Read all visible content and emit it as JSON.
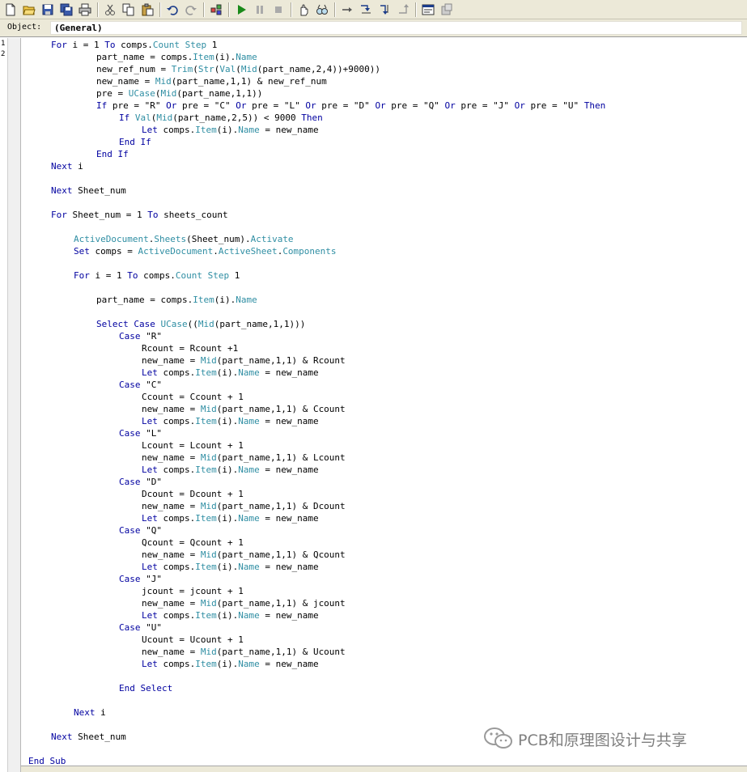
{
  "toolbar": {
    "icons": [
      "new-file-icon",
      "open-folder-icon",
      "save-icon",
      "save-all-icon",
      "print-icon",
      "cut-icon",
      "copy-icon",
      "paste-icon",
      "undo-icon",
      "redo-icon",
      "object-browser-icon",
      "run-icon",
      "pause-icon",
      "stop-icon",
      "hand-icon",
      "watch-icon",
      "step-icon",
      "step-into-icon",
      "step-over-icon",
      "step-out-icon",
      "properties-icon",
      "toggle-icon"
    ]
  },
  "object_bar": {
    "label": "Object:",
    "value": "(General)"
  },
  "gutter": {
    "line_numbers": [
      "1",
      "2"
    ]
  },
  "code": {
    "lines": [
      [
        {
          "t": "For",
          "c": "kw"
        },
        {
          "t": " i = 1 ",
          "c": "tx"
        },
        {
          "t": "To",
          "c": "kw"
        },
        {
          "t": " comps.",
          "c": "tx"
        },
        {
          "t": "Count",
          "c": "fn"
        },
        {
          "t": " ",
          "c": "tx"
        },
        {
          "t": "Step",
          "c": "fn"
        },
        {
          "t": " 1",
          "c": "tx"
        }
      ],
      [
        {
          "t": "part_name = comps.",
          "c": "tx"
        },
        {
          "t": "Item",
          "c": "fn"
        },
        {
          "t": "(i).",
          "c": "tx"
        },
        {
          "t": "Name",
          "c": "fn"
        }
      ],
      [
        {
          "t": "new_ref_num = ",
          "c": "tx"
        },
        {
          "t": "Trim",
          "c": "fn"
        },
        {
          "t": "(",
          "c": "tx"
        },
        {
          "t": "Str",
          "c": "fn"
        },
        {
          "t": "(",
          "c": "tx"
        },
        {
          "t": "Val",
          "c": "fn"
        },
        {
          "t": "(",
          "c": "tx"
        },
        {
          "t": "Mid",
          "c": "fn"
        },
        {
          "t": "(part_name,2,4))+9000))",
          "c": "tx"
        }
      ],
      [
        {
          "t": "new_name = ",
          "c": "tx"
        },
        {
          "t": "Mid",
          "c": "fn"
        },
        {
          "t": "(part_name,1,1) & new_ref_num",
          "c": "tx"
        }
      ],
      [
        {
          "t": "pre = ",
          "c": "tx"
        },
        {
          "t": "UCase",
          "c": "fn"
        },
        {
          "t": "(",
          "c": "tx"
        },
        {
          "t": "Mid",
          "c": "fn"
        },
        {
          "t": "(part_name,1,1))",
          "c": "tx"
        }
      ],
      [
        {
          "t": "If",
          "c": "kw"
        },
        {
          "t": " pre = \"R\" ",
          "c": "tx"
        },
        {
          "t": "Or",
          "c": "kw"
        },
        {
          "t": " pre = \"C\" ",
          "c": "tx"
        },
        {
          "t": "Or",
          "c": "kw"
        },
        {
          "t": " pre = \"L\" ",
          "c": "tx"
        },
        {
          "t": "Or",
          "c": "kw"
        },
        {
          "t": " pre = \"D\" ",
          "c": "tx"
        },
        {
          "t": "Or",
          "c": "kw"
        },
        {
          "t": " pre = \"Q\" ",
          "c": "tx"
        },
        {
          "t": "Or",
          "c": "kw"
        },
        {
          "t": " pre = \"J\" ",
          "c": "tx"
        },
        {
          "t": "Or",
          "c": "kw"
        },
        {
          "t": " pre = \"U\" ",
          "c": "tx"
        },
        {
          "t": "Then",
          "c": "kw"
        }
      ],
      [
        {
          "t": "If",
          "c": "kw"
        },
        {
          "t": " ",
          "c": "tx"
        },
        {
          "t": "Val",
          "c": "fn"
        },
        {
          "t": "(",
          "c": "tx"
        },
        {
          "t": "Mid",
          "c": "fn"
        },
        {
          "t": "(part_name,2,5)) < 9000 ",
          "c": "tx"
        },
        {
          "t": "Then",
          "c": "kw"
        }
      ],
      [
        {
          "t": "Let",
          "c": "kw"
        },
        {
          "t": " comps.",
          "c": "tx"
        },
        {
          "t": "Item",
          "c": "fn"
        },
        {
          "t": "(i).",
          "c": "tx"
        },
        {
          "t": "Name",
          "c": "fn"
        },
        {
          "t": " = new_name",
          "c": "tx"
        }
      ],
      [
        {
          "t": "End If",
          "c": "kw"
        }
      ],
      [
        {
          "t": "End If",
          "c": "kw"
        }
      ],
      [
        {
          "t": "Next",
          "c": "kw"
        },
        {
          "t": " i",
          "c": "tx"
        }
      ],
      [],
      [
        {
          "t": "Next",
          "c": "kw"
        },
        {
          "t": " Sheet_num",
          "c": "tx"
        }
      ],
      [],
      [
        {
          "t": "For",
          "c": "kw"
        },
        {
          "t": " Sheet_num = 1 ",
          "c": "tx"
        },
        {
          "t": "To",
          "c": "kw"
        },
        {
          "t": " sheets_count",
          "c": "tx"
        }
      ],
      [],
      [
        {
          "t": "ActiveDocument",
          "c": "fn"
        },
        {
          "t": ".",
          "c": "tx"
        },
        {
          "t": "Sheets",
          "c": "fn"
        },
        {
          "t": "(Sheet_num).",
          "c": "tx"
        },
        {
          "t": "Activate",
          "c": "fn"
        }
      ],
      [
        {
          "t": "Set",
          "c": "kw"
        },
        {
          "t": " comps = ",
          "c": "tx"
        },
        {
          "t": "ActiveDocument",
          "c": "fn"
        },
        {
          "t": ".",
          "c": "tx"
        },
        {
          "t": "ActiveSheet",
          "c": "fn"
        },
        {
          "t": ".",
          "c": "tx"
        },
        {
          "t": "Components",
          "c": "fn"
        }
      ],
      [],
      [
        {
          "t": "For",
          "c": "kw"
        },
        {
          "t": " i = 1 ",
          "c": "tx"
        },
        {
          "t": "To",
          "c": "kw"
        },
        {
          "t": " comps.",
          "c": "tx"
        },
        {
          "t": "Count",
          "c": "fn"
        },
        {
          "t": " ",
          "c": "tx"
        },
        {
          "t": "Step",
          "c": "fn"
        },
        {
          "t": " 1",
          "c": "tx"
        }
      ],
      [],
      [
        {
          "t": "part_name = comps.",
          "c": "tx"
        },
        {
          "t": "Item",
          "c": "fn"
        },
        {
          "t": "(i).",
          "c": "tx"
        },
        {
          "t": "Name",
          "c": "fn"
        }
      ],
      [],
      [
        {
          "t": "Select Case",
          "c": "kw"
        },
        {
          "t": " ",
          "c": "tx"
        },
        {
          "t": "UCase",
          "c": "fn"
        },
        {
          "t": "((",
          "c": "tx"
        },
        {
          "t": "Mid",
          "c": "fn"
        },
        {
          "t": "(part_name,1,1)))",
          "c": "tx"
        }
      ],
      [
        {
          "t": "Case",
          "c": "kw"
        },
        {
          "t": " \"R\"",
          "c": "tx"
        }
      ],
      [
        {
          "t": "Rcount = Rcount +1",
          "c": "tx"
        }
      ],
      [
        {
          "t": "new_name = ",
          "c": "tx"
        },
        {
          "t": "Mid",
          "c": "fn"
        },
        {
          "t": "(part_name,1,1) & Rcount",
          "c": "tx"
        }
      ],
      [
        {
          "t": "Let",
          "c": "kw"
        },
        {
          "t": " comps.",
          "c": "tx"
        },
        {
          "t": "Item",
          "c": "fn"
        },
        {
          "t": "(i).",
          "c": "tx"
        },
        {
          "t": "Name",
          "c": "fn"
        },
        {
          "t": " = new_name",
          "c": "tx"
        }
      ],
      [
        {
          "t": "Case",
          "c": "kw"
        },
        {
          "t": " \"C\"",
          "c": "tx"
        }
      ],
      [
        {
          "t": "Ccount = Ccount + 1",
          "c": "tx"
        }
      ],
      [
        {
          "t": "new_name = ",
          "c": "tx"
        },
        {
          "t": "Mid",
          "c": "fn"
        },
        {
          "t": "(part_name,1,1) & Ccount",
          "c": "tx"
        }
      ],
      [
        {
          "t": "Let",
          "c": "kw"
        },
        {
          "t": " comps.",
          "c": "tx"
        },
        {
          "t": "Item",
          "c": "fn"
        },
        {
          "t": "(i).",
          "c": "tx"
        },
        {
          "t": "Name",
          "c": "fn"
        },
        {
          "t": " = new_name",
          "c": "tx"
        }
      ],
      [
        {
          "t": "Case",
          "c": "kw"
        },
        {
          "t": " \"L\"",
          "c": "tx"
        }
      ],
      [
        {
          "t": "Lcount = Lcount + 1",
          "c": "tx"
        }
      ],
      [
        {
          "t": "new_name = ",
          "c": "tx"
        },
        {
          "t": "Mid",
          "c": "fn"
        },
        {
          "t": "(part_name,1,1) & Lcount",
          "c": "tx"
        }
      ],
      [
        {
          "t": "Let",
          "c": "kw"
        },
        {
          "t": " comps.",
          "c": "tx"
        },
        {
          "t": "Item",
          "c": "fn"
        },
        {
          "t": "(i).",
          "c": "tx"
        },
        {
          "t": "Name",
          "c": "fn"
        },
        {
          "t": " = new_name",
          "c": "tx"
        }
      ],
      [
        {
          "t": "Case",
          "c": "kw"
        },
        {
          "t": " \"D\"",
          "c": "tx"
        }
      ],
      [
        {
          "t": "Dcount = Dcount + 1",
          "c": "tx"
        }
      ],
      [
        {
          "t": "new_name = ",
          "c": "tx"
        },
        {
          "t": "Mid",
          "c": "fn"
        },
        {
          "t": "(part_name,1,1) & Dcount",
          "c": "tx"
        }
      ],
      [
        {
          "t": "Let",
          "c": "kw"
        },
        {
          "t": " comps.",
          "c": "tx"
        },
        {
          "t": "Item",
          "c": "fn"
        },
        {
          "t": "(i).",
          "c": "tx"
        },
        {
          "t": "Name",
          "c": "fn"
        },
        {
          "t": " = new_name",
          "c": "tx"
        }
      ],
      [
        {
          "t": "Case",
          "c": "kw"
        },
        {
          "t": " \"Q\"",
          "c": "tx"
        }
      ],
      [
        {
          "t": "Qcount = Qcount + 1",
          "c": "tx"
        }
      ],
      [
        {
          "t": "new_name = ",
          "c": "tx"
        },
        {
          "t": "Mid",
          "c": "fn"
        },
        {
          "t": "(part_name,1,1) & Qcount",
          "c": "tx"
        }
      ],
      [
        {
          "t": "Let",
          "c": "kw"
        },
        {
          "t": " comps.",
          "c": "tx"
        },
        {
          "t": "Item",
          "c": "fn"
        },
        {
          "t": "(i).",
          "c": "tx"
        },
        {
          "t": "Name",
          "c": "fn"
        },
        {
          "t": " = new_name",
          "c": "tx"
        }
      ],
      [
        {
          "t": "Case",
          "c": "kw"
        },
        {
          "t": " \"J\"",
          "c": "tx"
        }
      ],
      [
        {
          "t": "jcount = jcount + 1",
          "c": "tx"
        }
      ],
      [
        {
          "t": "new_name = ",
          "c": "tx"
        },
        {
          "t": "Mid",
          "c": "fn"
        },
        {
          "t": "(part_name,1,1) & jcount",
          "c": "tx"
        }
      ],
      [
        {
          "t": "Let",
          "c": "kw"
        },
        {
          "t": " comps.",
          "c": "tx"
        },
        {
          "t": "Item",
          "c": "fn"
        },
        {
          "t": "(i).",
          "c": "tx"
        },
        {
          "t": "Name",
          "c": "fn"
        },
        {
          "t": " = new_name",
          "c": "tx"
        }
      ],
      [
        {
          "t": "Case",
          "c": "kw"
        },
        {
          "t": " \"U\"",
          "c": "tx"
        }
      ],
      [
        {
          "t": "Ucount = Ucount + 1",
          "c": "tx"
        }
      ],
      [
        {
          "t": "new_name = ",
          "c": "tx"
        },
        {
          "t": "Mid",
          "c": "fn"
        },
        {
          "t": "(part_name,1,1) & Ucount",
          "c": "tx"
        }
      ],
      [
        {
          "t": "Let",
          "c": "kw"
        },
        {
          "t": " comps.",
          "c": "tx"
        },
        {
          "t": "Item",
          "c": "fn"
        },
        {
          "t": "(i).",
          "c": "tx"
        },
        {
          "t": "Name",
          "c": "fn"
        },
        {
          "t": " = new_name",
          "c": "tx"
        }
      ],
      [],
      [
        {
          "t": "End Select",
          "c": "kw"
        }
      ],
      [],
      [
        {
          "t": "Next",
          "c": "kw"
        },
        {
          "t": " i",
          "c": "tx"
        }
      ],
      [],
      [
        {
          "t": "Next",
          "c": "kw"
        },
        {
          "t": " Sheet_num",
          "c": "tx"
        }
      ],
      [],
      [
        {
          "t": "End Sub",
          "c": "kw"
        }
      ]
    ]
  },
  "watermark": {
    "text": "PCB和原理图设计与共享"
  },
  "colors": {
    "keyword": "#0000a0",
    "function": "#2f8ea3",
    "text": "#000000"
  }
}
